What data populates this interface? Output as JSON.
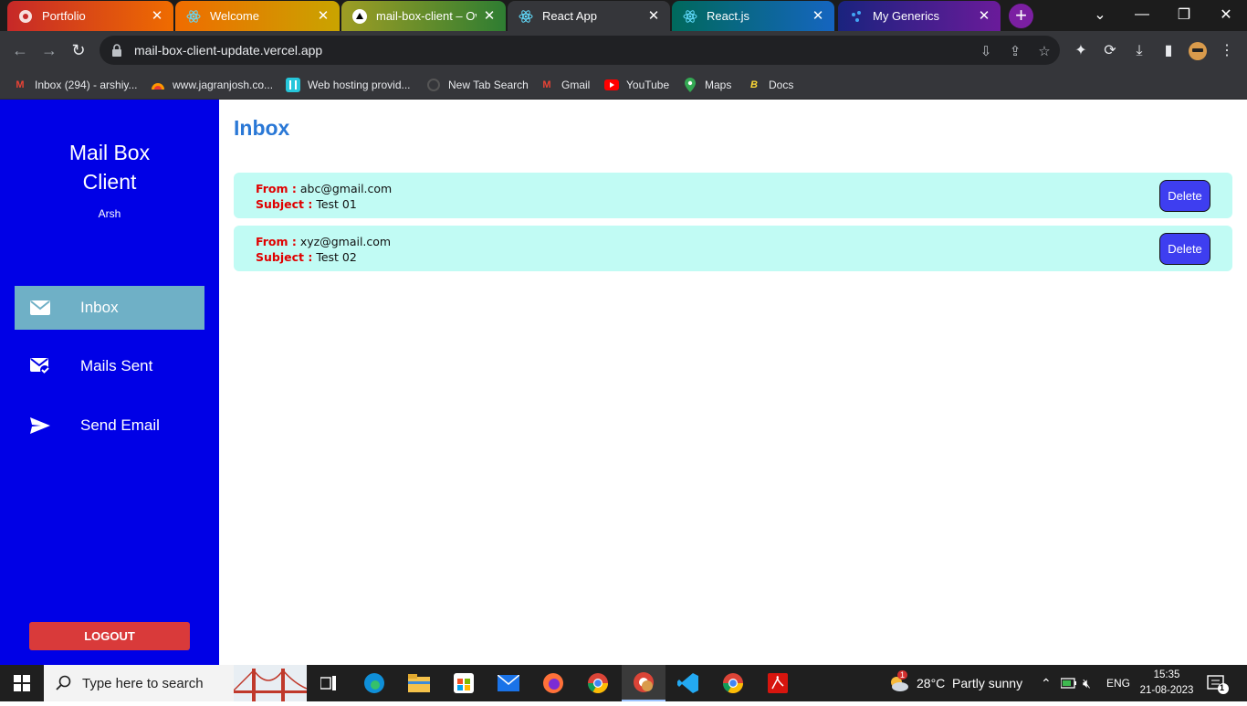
{
  "browser": {
    "tabs": [
      {
        "title": "Portfolio",
        "icon": "portfolio-icon"
      },
      {
        "title": "Welcome",
        "icon": "react-icon"
      },
      {
        "title": "mail-box-client – Over",
        "icon": "vercel-icon"
      },
      {
        "title": "React App",
        "icon": "react-icon"
      },
      {
        "title": "React.js",
        "icon": "react-icon"
      },
      {
        "title": "My Generics",
        "icon": "generics-icon"
      }
    ],
    "url": "mail-box-client-update.vercel.app",
    "bookmarks": [
      {
        "label": "Inbox (294) - arshiy...",
        "icon": "gmail-icon"
      },
      {
        "label": "www.jagranjosh.co...",
        "icon": "jagran-icon"
      },
      {
        "label": "Web hosting provid...",
        "icon": "hosting-icon"
      },
      {
        "label": "New Tab Search",
        "icon": "newtab-icon"
      },
      {
        "label": "Gmail",
        "icon": "gmail-icon"
      },
      {
        "label": "YouTube",
        "icon": "youtube-icon"
      },
      {
        "label": "Maps",
        "icon": "maps-icon"
      },
      {
        "label": "Docs",
        "icon": "docs-icon"
      }
    ]
  },
  "sidebar": {
    "brand": "Mail Box\nClient",
    "brand_line1": "Mail Box",
    "brand_line2": "Client",
    "username": "Arsh",
    "items": [
      {
        "label": "Inbox",
        "icon": "envelope-icon",
        "active": true
      },
      {
        "label": "Mails Sent",
        "icon": "envelope-check-icon",
        "active": false
      },
      {
        "label": "Send Email",
        "icon": "send-icon",
        "active": false
      }
    ],
    "logout_label": "LOGOUT"
  },
  "main": {
    "title": "Inbox",
    "from_label": "From :",
    "subject_label": "Subject :",
    "delete_label": "Delete",
    "mails": [
      {
        "from": "abc@gmail.com",
        "subject": "Test 01"
      },
      {
        "from": "xyz@gmail.com",
        "subject": "Test 02"
      }
    ]
  },
  "taskbar": {
    "search_placeholder": "Type here to search",
    "weather": "28°C  Partly sunny",
    "weather_badge": "1",
    "language": "ENG",
    "time": "15:35",
    "date": "21-08-2023",
    "notification_count": "1"
  },
  "colors": {
    "sidebar_bg": "#0000e6",
    "active_nav": "#6fb0c6",
    "title": "#2a78d6",
    "mail_bg": "#c1fbf4",
    "label_red": "#e00000",
    "delete_btn": "#3e3ef0",
    "logout_btn": "#d93a3a"
  }
}
